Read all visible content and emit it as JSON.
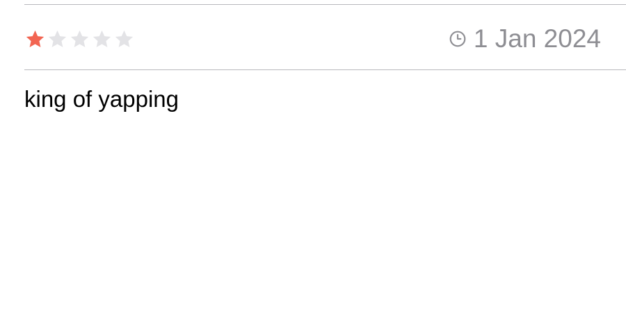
{
  "review": {
    "rating": 1,
    "max_rating": 5,
    "date": "1 Jan 2024",
    "body": "king of yapping"
  },
  "icons": {
    "star": "star-icon",
    "clock": "clock-icon"
  },
  "colors": {
    "star_filled": "#f26552",
    "star_empty": "#e3e3e6",
    "meta_text": "#8e8e93",
    "divider": "#b8b8bc",
    "body_text": "#000000"
  }
}
